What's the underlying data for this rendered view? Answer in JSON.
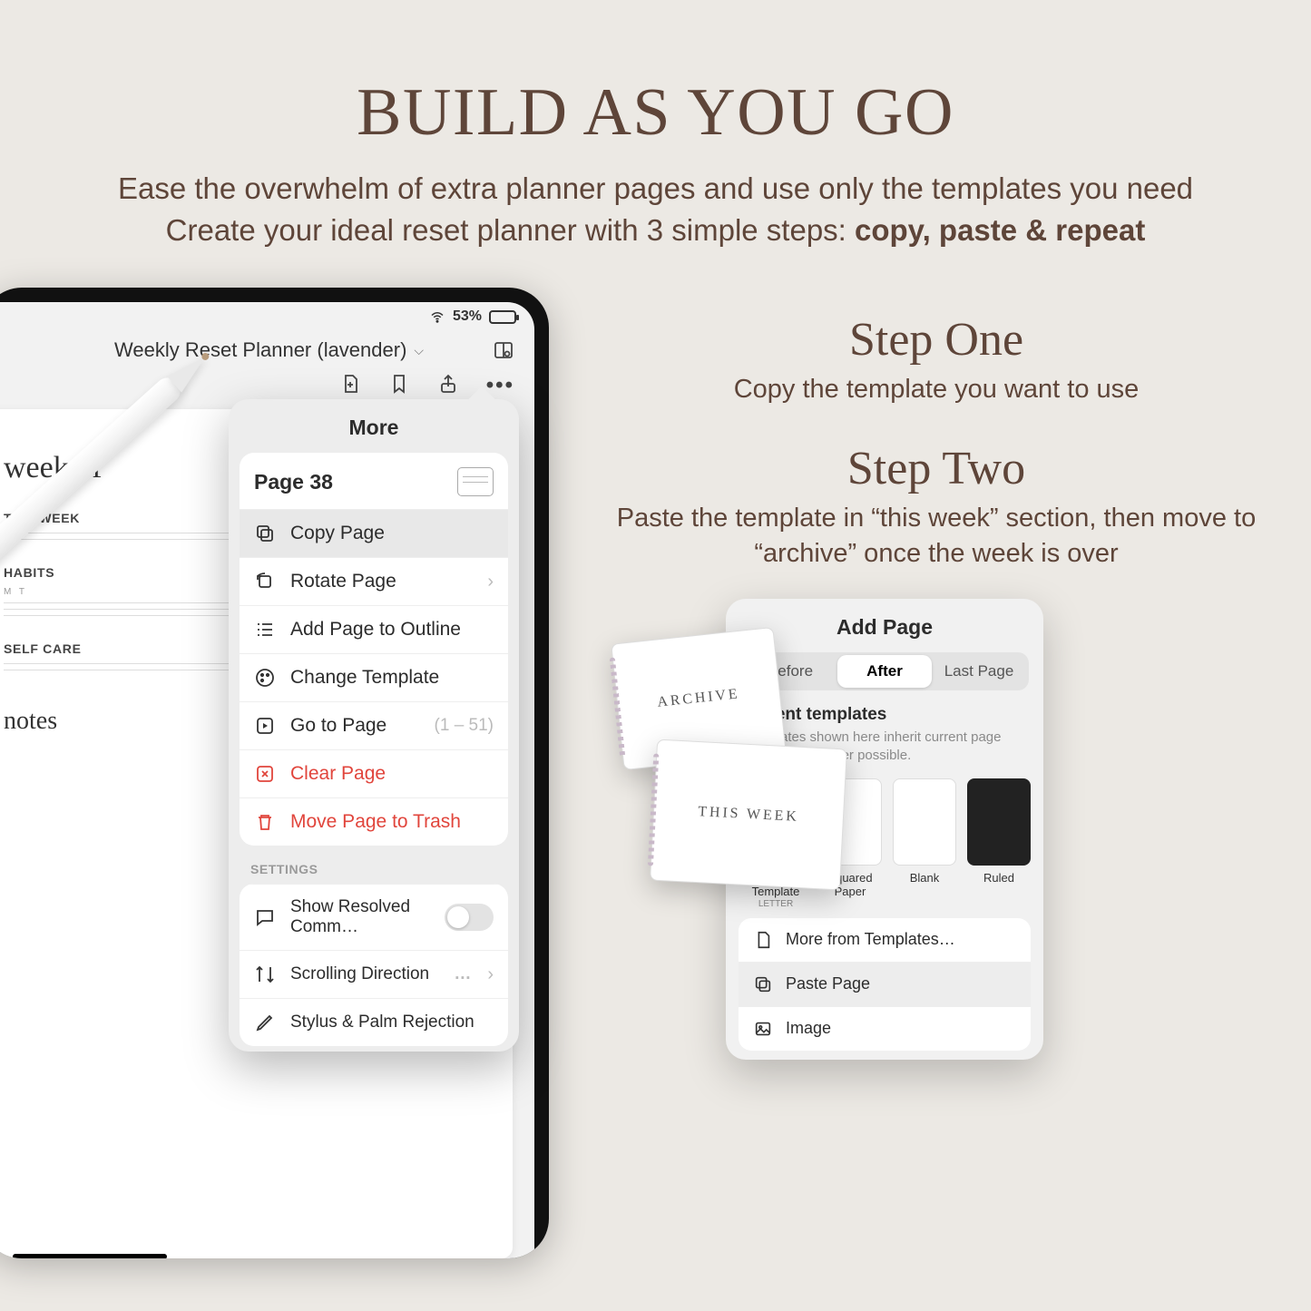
{
  "hero": {
    "title": "BUILD AS YOU GO",
    "line1": "Ease the overwhelm of extra planner pages and use only the templates you need",
    "line2_a": "Create your ideal reset planner with 3 simple steps: ",
    "line2_b": "copy, paste & repeat"
  },
  "steps": {
    "s1_title": "Step One",
    "s1_body": "Copy the template you want to use",
    "s2_title": "Step Two",
    "s2_body": "Paste the template in “this week” section, then move to “archive” once the week is over"
  },
  "status": {
    "battery_pct": "53%"
  },
  "doc": {
    "title": "Weekly Reset Planner (lavender)"
  },
  "paper": {
    "script": "week of",
    "s_thisweek": "THIS WEEK",
    "s_habits": "HABITS",
    "days": "M      T",
    "s_selfcare": "SELF CARE",
    "script_notes": "notes"
  },
  "more": {
    "title": "More",
    "page_label": "Page 38",
    "copy": "Copy Page",
    "rotate": "Rotate Page",
    "outline": "Add Page to Outline",
    "change_tpl": "Change Template",
    "goto": "Go to Page",
    "range": "(1 – 51)",
    "clear": "Clear Page",
    "trash": "Move Page to Trash",
    "settings": "SETTINGS",
    "resolved": "Show Resolved Comm…",
    "scroll": "Scrolling Direction",
    "ellipsis": "…",
    "stylus": "Stylus & Palm Rejection"
  },
  "addpage": {
    "title": "Add Page",
    "seg_before": "Before",
    "seg_after": "After",
    "seg_last": "Last Page",
    "subhead": "Recent templates",
    "note": "Templates shown here inherit current page settings whenever possible.",
    "tpl1": "Current Template",
    "tpl1_sub": "LETTER",
    "tpl2": "Squared Paper",
    "tpl3": "Blank",
    "tpl4": "Ruled",
    "more_tpl": "More from Templates…",
    "paste": "Paste Page",
    "image": "Image"
  },
  "cards": {
    "archive": "ARCHIVE",
    "thisweek": "THIS WEEK"
  }
}
